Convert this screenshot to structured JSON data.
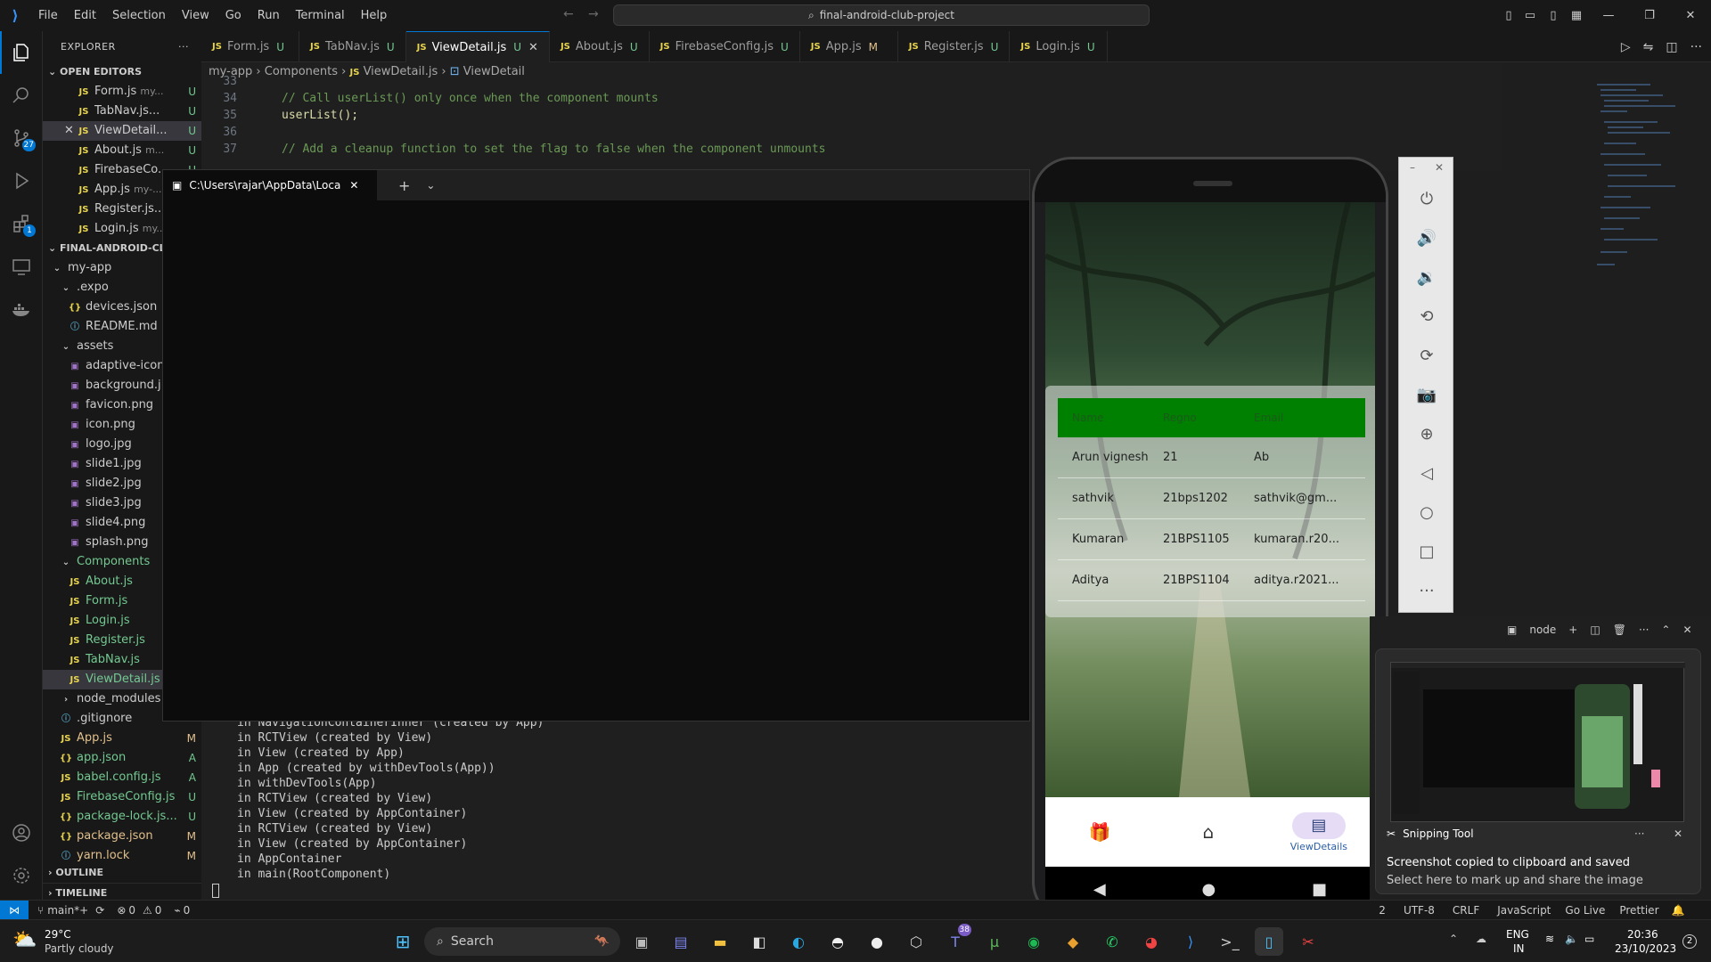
{
  "titlebar": {
    "menus": [
      "File",
      "Edit",
      "Selection",
      "View",
      "Go",
      "Run",
      "Terminal",
      "Help"
    ],
    "search": "final-android-club-project"
  },
  "activity": {
    "scm_badge": "27",
    "ext_badge": "1"
  },
  "explorer": {
    "title": "EXPLORER",
    "open_editors_label": "OPEN EDITORS",
    "open_editors": [
      {
        "name": "Form.js",
        "hint": "my...",
        "status": "U"
      },
      {
        "name": "TabNav.js...",
        "hint": "",
        "status": "U"
      },
      {
        "name": "ViewDetail...",
        "hint": "",
        "status": "U"
      },
      {
        "name": "About.js",
        "hint": "m...",
        "status": "U"
      },
      {
        "name": "FirebaseCo...",
        "hint": "",
        "status": "U"
      },
      {
        "name": "App.js",
        "hint": "my-...",
        "status": ""
      },
      {
        "name": "Register.js...",
        "hint": "",
        "status": "U"
      },
      {
        "name": "Login.js",
        "hint": "my...",
        "status": "U"
      }
    ],
    "project_label": "FINAL-ANDROID-CLUB-...",
    "tree": [
      {
        "name": "my-app",
        "type": "folder",
        "depth": 0,
        "status": ""
      },
      {
        "name": ".expo",
        "type": "folder",
        "depth": 1,
        "status": ""
      },
      {
        "name": "devices.json",
        "type": "json",
        "depth": 2,
        "status": ""
      },
      {
        "name": "README.md",
        "type": "info",
        "depth": 2,
        "status": ""
      },
      {
        "name": "assets",
        "type": "folder",
        "depth": 1,
        "status": ""
      },
      {
        "name": "adaptive-icon...",
        "type": "img",
        "depth": 2,
        "status": ""
      },
      {
        "name": "background.j...",
        "type": "img",
        "depth": 2,
        "status": ""
      },
      {
        "name": "favicon.png",
        "type": "img",
        "depth": 2,
        "status": ""
      },
      {
        "name": "icon.png",
        "type": "img",
        "depth": 2,
        "status": ""
      },
      {
        "name": "logo.jpg",
        "type": "img",
        "depth": 2,
        "status": ""
      },
      {
        "name": "slide1.jpg",
        "type": "img",
        "depth": 2,
        "status": ""
      },
      {
        "name": "slide2.jpg",
        "type": "img",
        "depth": 2,
        "status": ""
      },
      {
        "name": "slide3.jpg",
        "type": "img",
        "depth": 2,
        "status": ""
      },
      {
        "name": "slide4.png",
        "type": "img",
        "depth": 2,
        "status": ""
      },
      {
        "name": "splash.png",
        "type": "img",
        "depth": 2,
        "status": ""
      },
      {
        "name": "Components",
        "type": "folder",
        "depth": 1,
        "status": ""
      },
      {
        "name": "About.js",
        "type": "js",
        "depth": 2,
        "status": ""
      },
      {
        "name": "Form.js",
        "type": "js",
        "depth": 2,
        "status": ""
      },
      {
        "name": "Login.js",
        "type": "js",
        "depth": 2,
        "status": ""
      },
      {
        "name": "Register.js",
        "type": "js",
        "depth": 2,
        "status": ""
      },
      {
        "name": "TabNav.js",
        "type": "js",
        "depth": 2,
        "status": ""
      },
      {
        "name": "ViewDetail.js",
        "type": "js",
        "depth": 2,
        "status": ""
      },
      {
        "name": "node_modules",
        "type": "folder-closed",
        "depth": 1,
        "status": ""
      },
      {
        "name": ".gitignore",
        "type": "info",
        "depth": 1,
        "status": ""
      },
      {
        "name": "App.js",
        "type": "js",
        "depth": 1,
        "status": "M"
      },
      {
        "name": "app.json",
        "type": "json",
        "depth": 1,
        "status": "A"
      },
      {
        "name": "babel.config.js",
        "type": "js",
        "depth": 1,
        "status": "A"
      },
      {
        "name": "FirebaseConfig.js",
        "type": "js",
        "depth": 1,
        "status": "U"
      },
      {
        "name": "package-lock.js...",
        "type": "json",
        "depth": 1,
        "status": "U"
      },
      {
        "name": "package.json",
        "type": "json",
        "depth": 1,
        "status": "M"
      },
      {
        "name": "yarn.lock",
        "type": "info",
        "depth": 1,
        "status": "M"
      }
    ],
    "outline_label": "OUTLINE",
    "timeline_label": "TIMELINE"
  },
  "tabs": [
    {
      "name": "Form.js",
      "status": "U"
    },
    {
      "name": "TabNav.js",
      "status": "U"
    },
    {
      "name": "ViewDetail.js",
      "status": "U"
    },
    {
      "name": "About.js",
      "status": "U"
    },
    {
      "name": "FirebaseConfig.js",
      "status": "U"
    },
    {
      "name": "App.js",
      "status": "M"
    },
    {
      "name": "Register.js",
      "status": "U"
    },
    {
      "name": "Login.js",
      "status": "U"
    }
  ],
  "breadcrumb": {
    "a": "my-app",
    "b": "Components",
    "c": "ViewDetail.js",
    "d": "ViewDetail"
  },
  "code": [
    {
      "n": "33",
      "t": ""
    },
    {
      "n": "34",
      "t": "// Call userList() only once when the component mounts"
    },
    {
      "n": "35",
      "t": "userList();"
    },
    {
      "n": "36",
      "t": ""
    },
    {
      "n": "37",
      "t": "// Add a cleanup function to set the flag to false when the component unmounts"
    }
  ],
  "terminal_lines": [
    "in NavigationContainerInner (created by App)",
    "in RCTView (created by View)",
    "in View (created by App)",
    "in App (created by withDevTools(App))",
    "in withDevTools(App)",
    "in RCTView (created by View)",
    "in View (created by AppContainer)",
    "in RCTView (created by View)",
    "in View (created by AppContainer)",
    "in AppContainer",
    "in main(RootComponent)"
  ],
  "wt": {
    "tab": "C:\\Users\\rajar\\AppData\\Local"
  },
  "phone": {
    "headers": [
      "Name",
      "Regno",
      "Email"
    ],
    "rows": [
      [
        "Arun vignesh",
        "21",
        "Ab"
      ],
      [
        "sathvik",
        "21bps1202",
        "sathvik@gm..."
      ],
      [
        "Kumaran",
        "21BPS1105",
        "kumaran.r20..."
      ],
      [
        "Aditya",
        "21BPS1104",
        "aditya.r2021..."
      ]
    ],
    "nav_active": "ViewDetails"
  },
  "termpanel": {
    "shell": "node"
  },
  "snip": {
    "app": "Snipping Tool",
    "title": "Screenshot copied to clipboard and saved",
    "body": "Select here to mark up and share the image"
  },
  "statusbar": {
    "branch": "main*+",
    "errors": "0",
    "warnings": "0",
    "ports": "0",
    "pos": "2",
    "enc": "UTF-8",
    "eol": "CRLF",
    "lang": "JavaScript",
    "live": "Go Live",
    "prettier": "Prettier"
  },
  "taskbar": {
    "temp": "29°C",
    "weather": "Partly cloudy",
    "search": "Search",
    "teams_badge": "38",
    "lang1": "ENG",
    "lang2": "IN",
    "time": "20:36",
    "date": "23/10/2023",
    "notif": "2"
  },
  "colors": {
    "accent": "#0078d4",
    "table_header": "#008000",
    "untracked": "#73c991",
    "modified": "#e2c08d"
  }
}
